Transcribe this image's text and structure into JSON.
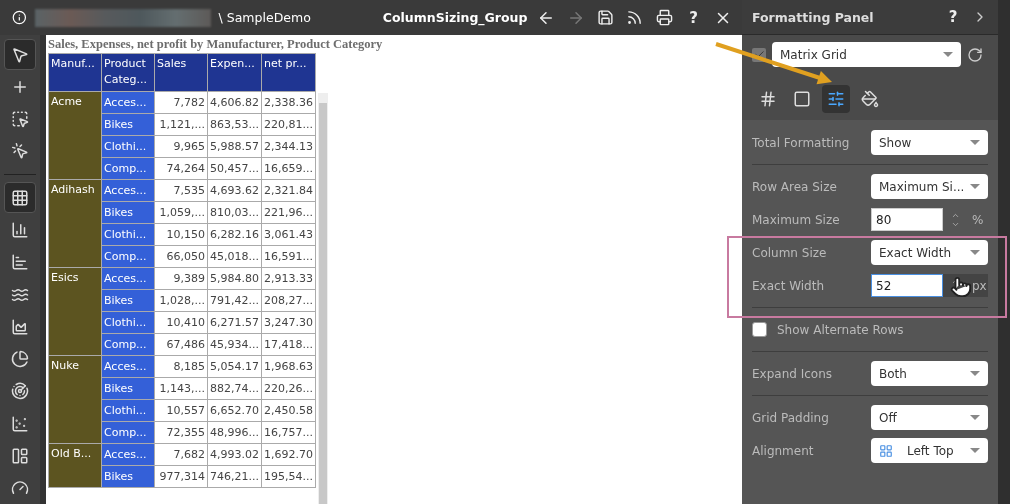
{
  "title_bar": {
    "path_suffix": "\\ SampleDemo",
    "title": "ColumnSizing_Group",
    "help_label": "?"
  },
  "toolbar": {
    "tools": [
      {
        "kind": "pointer",
        "selected": true
      },
      {
        "kind": "add",
        "selected": false
      },
      {
        "kind": "select-area",
        "selected": false
      },
      {
        "kind": "select-point",
        "selected": false
      },
      {
        "kind": "grid",
        "selected": true
      },
      {
        "kind": "column",
        "selected": false
      },
      {
        "kind": "bar",
        "selected": false
      },
      {
        "kind": "line",
        "selected": false
      },
      {
        "kind": "area",
        "selected": false
      },
      {
        "kind": "pie",
        "selected": false
      },
      {
        "kind": "radar",
        "selected": false
      },
      {
        "kind": "scatter",
        "selected": false
      },
      {
        "kind": "treemap",
        "selected": false
      },
      {
        "kind": "gauge",
        "selected": false
      }
    ]
  },
  "grid": {
    "title": "Sales, Expenses, net profit by Manufacturer, Product Category",
    "columns": [
      "Manuf...",
      "Product Categ...",
      "Sales",
      "Expen...",
      "net pr..."
    ],
    "groups": [
      {
        "manufacturer": "Acme",
        "rows": [
          {
            "category": "Acces...",
            "sales": "7,782",
            "expenses": "4,606.82",
            "net_profit": "2,338.36"
          },
          {
            "category": "Bikes",
            "sales": "1,121,...",
            "expenses": "863,53...",
            "net_profit": "220,81..."
          },
          {
            "category": "Clothi...",
            "sales": "9,965",
            "expenses": "5,988.57",
            "net_profit": "2,344.13"
          },
          {
            "category": "Comp...",
            "sales": "74,264",
            "expenses": "50,457...",
            "net_profit": "16,659..."
          }
        ]
      },
      {
        "manufacturer": "Adihash",
        "rows": [
          {
            "category": "Acces...",
            "sales": "7,535",
            "expenses": "4,693.62",
            "net_profit": "2,321.84"
          },
          {
            "category": "Bikes",
            "sales": "1,059,...",
            "expenses": "810,03...",
            "net_profit": "221,96..."
          },
          {
            "category": "Clothi...",
            "sales": "10,150",
            "expenses": "6,282.16",
            "net_profit": "3,061.43"
          },
          {
            "category": "Comp...",
            "sales": "66,050",
            "expenses": "45,018...",
            "net_profit": "16,591..."
          }
        ]
      },
      {
        "manufacturer": "Esics",
        "rows": [
          {
            "category": "Acces...",
            "sales": "9,389",
            "expenses": "5,984.80",
            "net_profit": "2,913.33"
          },
          {
            "category": "Bikes",
            "sales": "1,028,...",
            "expenses": "791,42...",
            "net_profit": "208,27..."
          },
          {
            "category": "Clothi...",
            "sales": "10,410",
            "expenses": "6,271.57",
            "net_profit": "3,247.30"
          },
          {
            "category": "Comp...",
            "sales": "67,486",
            "expenses": "45,934...",
            "net_profit": "17,418..."
          }
        ]
      },
      {
        "manufacturer": "Nuke",
        "rows": [
          {
            "category": "Acces...",
            "sales": "8,185",
            "expenses": "5,054.17",
            "net_profit": "1,968.63"
          },
          {
            "category": "Bikes",
            "sales": "1,143,...",
            "expenses": "882,74...",
            "net_profit": "220,26..."
          },
          {
            "category": "Clothi...",
            "sales": "10,557",
            "expenses": "6,652.70",
            "net_profit": "2,450.58"
          },
          {
            "category": "Comp...",
            "sales": "72,355",
            "expenses": "48,996...",
            "net_profit": "16,757..."
          }
        ]
      },
      {
        "manufacturer": "Old B...",
        "rows": [
          {
            "category": "Acces...",
            "sales": "7,682",
            "expenses": "4,993.02",
            "net_profit": "1,692.70"
          },
          {
            "category": "Bikes",
            "sales": "977,314",
            "expenses": "746,21...",
            "net_profit": "195,54..."
          }
        ]
      }
    ]
  },
  "panel": {
    "title": "Formatting Panel",
    "help_label": "?",
    "visual_enabled": true,
    "visual_type": "Matrix Grid",
    "tabs": [
      {
        "kind": "labels",
        "selected": false
      },
      {
        "kind": "frame",
        "selected": false
      },
      {
        "kind": "sliders",
        "selected": true
      },
      {
        "kind": "paint",
        "selected": false
      }
    ],
    "settings": [
      {
        "kind": "select",
        "label": "Total Formatting",
        "value": "Show",
        "divider_after": true
      },
      {
        "kind": "select",
        "label": "Row Area Size",
        "value": "Maximum Si...",
        "divider_after": false
      },
      {
        "kind": "number",
        "label": "Maximum Size",
        "value": "80",
        "unit": "%",
        "focused": false,
        "divider_after": false
      },
      {
        "kind": "select",
        "label": "Column Size",
        "value": "Exact Width",
        "divider_after": false
      },
      {
        "kind": "number",
        "label": "Exact Width",
        "value": "52",
        "unit": "px",
        "focused": true,
        "divider_after": true
      },
      {
        "kind": "checkbox",
        "label": "Show Alternate Rows",
        "checked": false,
        "divider_after": true
      },
      {
        "kind": "select",
        "label": "Expand Icons",
        "value": "Both",
        "divider_after": true
      },
      {
        "kind": "select",
        "label": "Grid Padding",
        "value": "Off",
        "divider_after": false
      },
      {
        "kind": "align-select",
        "label": "Alignment",
        "value": "Left Top",
        "divider_after": false
      }
    ]
  }
}
